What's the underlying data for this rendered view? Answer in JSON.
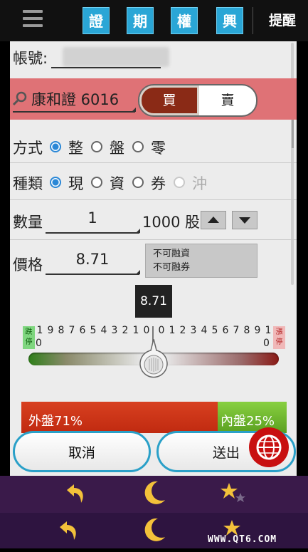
{
  "nav": {
    "tabs": [
      "證",
      "期",
      "權",
      "興"
    ],
    "remind_label": "提醒"
  },
  "form": {
    "account_label": "帳號:",
    "stock_field": "康和證 6016",
    "buy_label": "買",
    "sell_label": "賣",
    "method_label": "方式",
    "method_options": [
      "整",
      "盤",
      "零"
    ],
    "method_selected": "整",
    "type_label": "種類",
    "type_options": [
      "現",
      "資",
      "券",
      "沖"
    ],
    "type_selected": "現",
    "quantity_label": "數量",
    "quantity_value": "1",
    "quantity_unit": "1000 股",
    "price_label": "價格",
    "price_value": "8.71",
    "info_line1": "不可融資",
    "info_line2": "不可融券"
  },
  "slider": {
    "price_popup": "8.71",
    "down_limit_label": "跌停",
    "up_limit_label": "漲停",
    "ticks_left": [
      "1",
      "9",
      "8",
      "7",
      "6",
      "5",
      "4",
      "3",
      "2",
      "1",
      "0"
    ],
    "ticks_right": [
      "0",
      "1",
      "2",
      "3",
      "4",
      "5",
      "6",
      "7",
      "8",
      "9",
      "1"
    ],
    "zero_left": "0",
    "zero_right": "0"
  },
  "ratio": {
    "outer_label": "外盤71%",
    "inner_label": "內盤25%",
    "outer_percent": 71,
    "inner_percent": 25
  },
  "actions": {
    "cancel_label": "取消",
    "send_label": "送出"
  },
  "bottom_icons": [
    "undo-arrow-icon",
    "moon-icon",
    "stars-icon"
  ],
  "watermark": "WWW.QT6.COM",
  "colors": {
    "accent": "#2aa6d6",
    "buy": "#8a2a16",
    "stock_band": "#df7276",
    "outer": "#c02a10",
    "inner": "#5aa020"
  }
}
